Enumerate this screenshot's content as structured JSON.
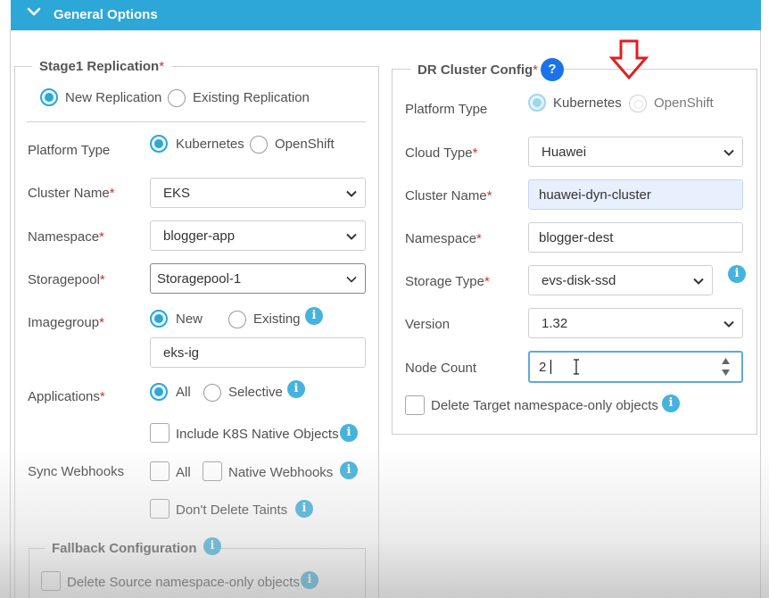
{
  "header": {
    "title": "General Options"
  },
  "stage1": {
    "legend": "Stage1 Replication",
    "replication_options": [
      "New Replication",
      "Existing Replication"
    ],
    "platform_type": {
      "label": "Platform Type",
      "options": [
        "Kubernetes",
        "OpenShift"
      ]
    },
    "cluster_name": {
      "label": "Cluster Name",
      "value": "EKS"
    },
    "namespace": {
      "label": "Namespace",
      "value": "blogger-app"
    },
    "storagepool": {
      "label": "Storagepool",
      "value": "Storagepool-1"
    },
    "imagegroup": {
      "label": "Imagegroup",
      "options": [
        "New",
        "Existing"
      ],
      "value": "eks-ig"
    },
    "applications": {
      "label": "Applications",
      "options": [
        "All",
        "Selective"
      ],
      "include_native": "Include K8S Native Objects"
    },
    "sync_webhooks": {
      "label": "Sync Webhooks",
      "options": [
        "All",
        "Native Webhooks"
      ]
    },
    "dont_delete_taints": "Don't Delete Taints"
  },
  "fallback": {
    "legend": "Fallback Configuration",
    "delete_source": "Delete Source namespace-only objects"
  },
  "dr": {
    "legend": "DR Cluster Config",
    "help": "?",
    "platform_type": {
      "label": "Platform Type",
      "options": [
        "Kubernetes",
        "OpenShift"
      ]
    },
    "cloud_type": {
      "label": "Cloud Type",
      "value": "Huawei"
    },
    "cluster_name": {
      "label": "Cluster Name",
      "value": "huawei-dyn-cluster"
    },
    "namespace": {
      "label": "Namespace",
      "value": "blogger-dest"
    },
    "storage_type": {
      "label": "Storage Type",
      "value": "evs-disk-ssd"
    },
    "version": {
      "label": "Version",
      "value": "1.32"
    },
    "node_count": {
      "label": "Node Count",
      "value": "2"
    },
    "delete_target": "Delete Target namespace-only objects"
  },
  "required_mark": "*",
  "info_glyph": "i",
  "colors": {
    "accent": "#2ca7d8",
    "help": "#1a73e8",
    "required": "#c0392b",
    "annotation_arrow": "#e02020"
  }
}
